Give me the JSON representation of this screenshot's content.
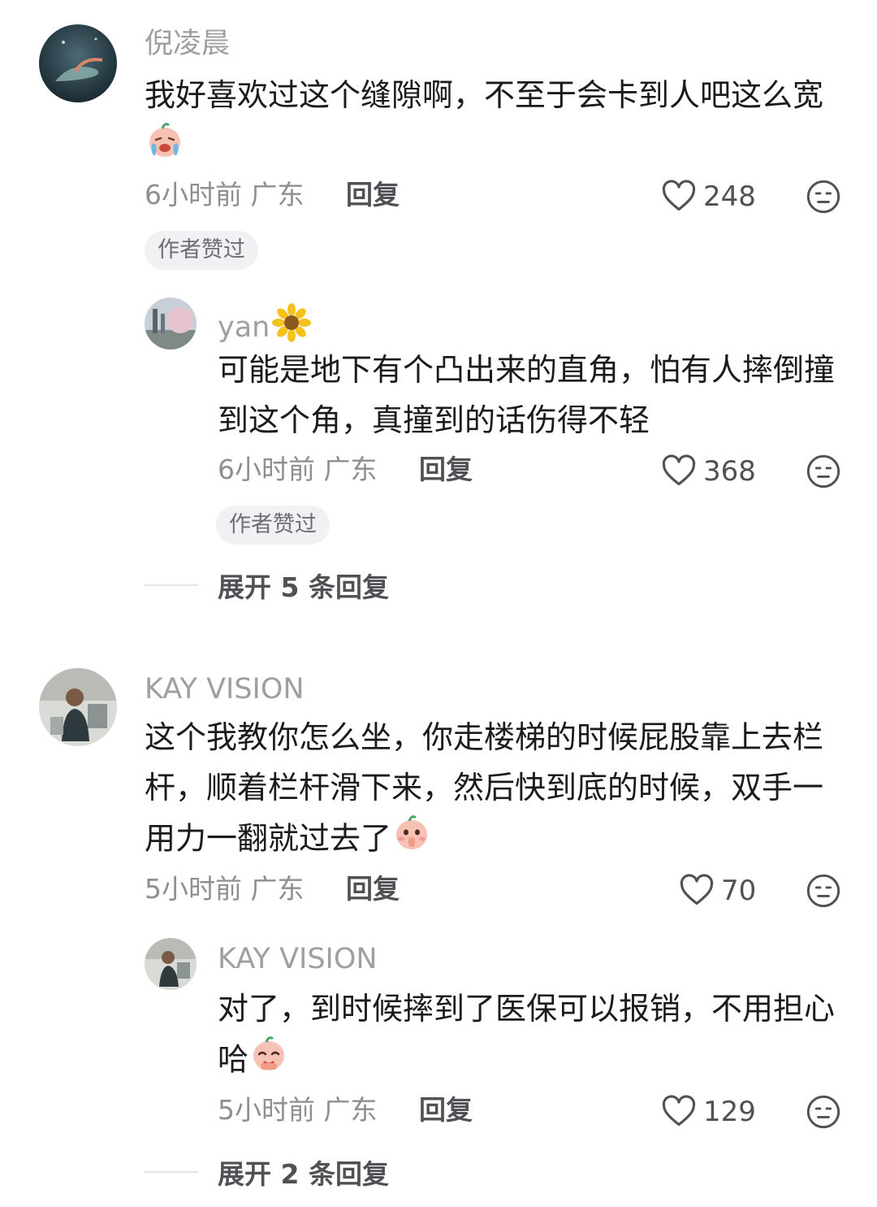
{
  "comments": [
    {
      "username": "倪凌晨",
      "text": "我好喜欢过这个缝隙啊，不至于会卡到人吧这么宽",
      "time": "6小时前",
      "location": "广东",
      "reply_label": "回复",
      "likes": "248",
      "badge": "作者赞过",
      "emoji": "crying-laughing-emoji",
      "replies": [
        {
          "username": "yan",
          "name_emoji": "sunflower-emoji",
          "text": "可能是地下有个凸出来的直角，怕有人摔倒撞到这个角，真撞到的话伤得不轻",
          "time": "6小时前",
          "location": "广东",
          "reply_label": "回复",
          "likes": "368",
          "badge": "作者赞过"
        }
      ],
      "expand_label": "展开 5 条回复"
    },
    {
      "username": "KAY VISION",
      "text": "这个我教你怎么坐，你走楼梯的时候屁股靠上去栏杆，顺着栏杆滑下来，然后快到底的时候，双手一用力一翻就过去了",
      "time": "5小时前",
      "location": "广东",
      "reply_label": "回复",
      "likes": "70",
      "emoji": "shush-emoji",
      "replies": [
        {
          "username": "KAY VISION",
          "text": "对了，到时候摔到了医保可以报销，不用担心哈",
          "time": "5小时前",
          "location": "广东",
          "reply_label": "回复",
          "likes": "129",
          "emoji": "pleading-emoji"
        }
      ],
      "expand_label": "展开 2 条回复"
    }
  ],
  "colors": {
    "text": "#1b1b1f",
    "muted": "#8e8e93",
    "username": "#9e9ea3",
    "badge_bg": "#f1f1f3"
  }
}
